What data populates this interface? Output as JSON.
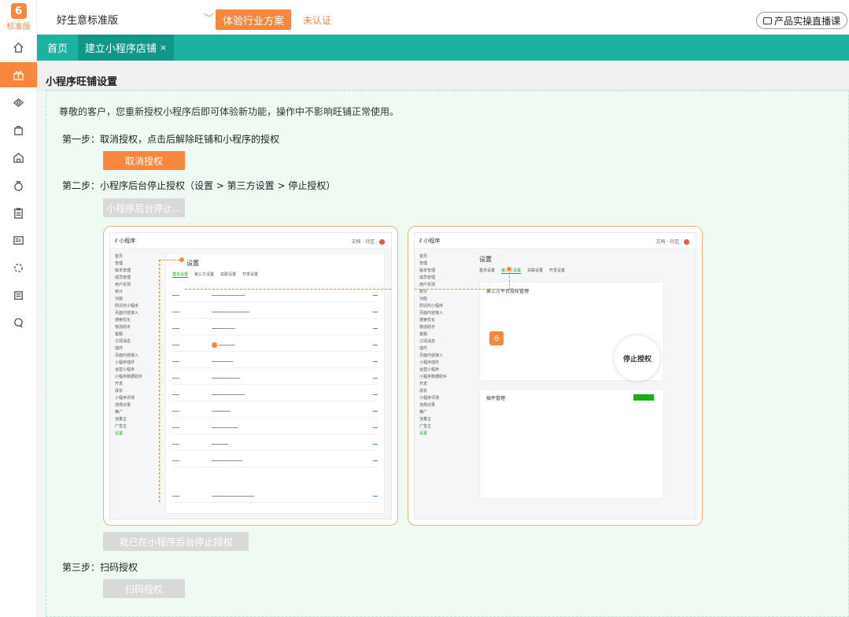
{
  "logo": {
    "mark": "6",
    "text": "标准版"
  },
  "topbar": {
    "store_name": "好生意标准版",
    "solution_button": "体验行业方案",
    "unverified": "未认证",
    "live_course": "产品实操直播课"
  },
  "tabs": [
    {
      "label": "首页"
    },
    {
      "label": "建立小程序店铺",
      "close": "×"
    }
  ],
  "page": {
    "title": "小程序旺铺设置",
    "notice": "尊敬的客户，您重新授权小程序后即可体验新功能，操作中不影响旺铺正常使用。",
    "step1": "第一步：取消授权，点击后解除旺铺和小程序的授权",
    "step1_button": "取消授权",
    "step2": "第二步：小程序后台停止授权（设置 > 第三方设置 > 停止授权）",
    "step2_button": "小程序后台停止...",
    "confirm_button": "我已在小程序后台停止授权",
    "step3": "第三步：扫码授权",
    "step3_button": "扫码授权"
  },
  "screens": {
    "left": {
      "brand": "小程序",
      "settings_title": "设置",
      "tabs": [
        "基本设置",
        "第三方设置",
        "关联设置",
        "开发设置"
      ],
      "nav": [
        "首页",
        "管理",
        "版本管理",
        "成员管理",
        "用户反馈",
        "统计",
        "功能",
        "附近的小程序",
        "页面内容接入",
        "搜索优化",
        "物流助手",
        "客服",
        "订阅消息",
        "插件",
        "页面内容接入",
        "小程序插件",
        "运营小程序",
        "小程序数据助手",
        "开发",
        "成长",
        "小程序评测",
        "违规记录",
        "推广",
        "流量主",
        "广告主",
        "设置"
      ]
    },
    "right": {
      "brand": "小程序",
      "settings_title": "设置",
      "section": "第三方平台授权管理",
      "plugin": "插件管理",
      "stop_label": "停止授权"
    }
  },
  "icons": [
    "home-icon",
    "gift-icon",
    "shop-icon",
    "bag-icon",
    "store-icon",
    "moneybag-icon",
    "clipboard-icon",
    "report-icon",
    "loading-icon",
    "news-icon",
    "chat-icon"
  ],
  "colors": {
    "accent": "#f7873e",
    "teal": "#1bb3a0",
    "teal_dark": "#109787",
    "panel_bg": "#effaf3"
  }
}
